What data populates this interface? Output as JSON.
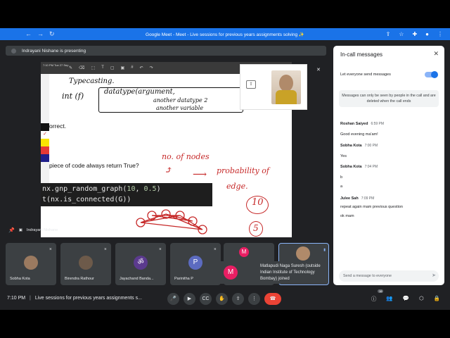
{
  "browser": {
    "tab_title": "Google Meet - Meet - Live sessions for previous years assignments solving ✨",
    "nav_back": "←",
    "nav_forward": "→",
    "reload": "↻"
  },
  "meet": {
    "presenting_text": "Indrayani Nishane is presenting",
    "presenter_label": "Indrayani Nishane",
    "slide": {
      "wb_time": "7:10 PM",
      "wb_date": "Tue 27 Sep",
      "text_correct": "orrect.",
      "text_question": "piece of code always return True?",
      "code_line1_pre": "nx.gnp_random_graph(",
      "code_line1_num1": "10",
      "code_line1_sep": ", ",
      "code_line1_num2": "0.5",
      "code_line1_post": ")",
      "code_line2": "t(nx.is_connected(G))",
      "ink_typecasting": "Typecasting.",
      "ink_int": "int (f)",
      "ink_datatype": "datatype(argument,",
      "ink_another1": "another datatype 2",
      "ink_another2": "another variable",
      "ink_nodes": "no. of nodes",
      "ink_prob": "probability of",
      "ink_edge": "edge.",
      "ink_ten": "10",
      "ink_five": "5"
    },
    "participants": [
      {
        "name": "Sobha Kota",
        "avatar": ""
      },
      {
        "name": "Birendra Rathour",
        "avatar": ""
      },
      {
        "name": "Jayachand Banda...",
        "avatar": "ॐ"
      },
      {
        "name": "Parinitha P",
        "avatar": "P"
      },
      {
        "name": "",
        "avatar": "M"
      }
    ],
    "toast": {
      "avatar": "M",
      "text": "Matlapudi Naga Suresh (outside Indian Institute of Technology Bombay) joined"
    },
    "bottom": {
      "time": "7:10 PM",
      "separator": "|",
      "meeting_title": "Live sessions for previous years assignments s...",
      "people_count": "16"
    }
  },
  "chat": {
    "title": "In-call messages",
    "allow_label": "Let everyone send messages",
    "note": "Messages can only be seen by people in the call and are deleted when the call ends",
    "messages": [
      {
        "sender": "Roshan Saiyed",
        "time": "6:59 PM",
        "lines": [
          "Good evening ma'am!"
        ]
      },
      {
        "sender": "Sobha Kota",
        "time": "7:00 PM",
        "lines": [
          "Yes"
        ]
      },
      {
        "sender": "Sobha Kota",
        "time": "7:04 PM",
        "lines": [
          "b",
          "a"
        ]
      },
      {
        "sender": "Julee Sah",
        "time": "7:09 PM",
        "lines": [
          "repeat again mam previous question",
          "ok mam"
        ]
      }
    ],
    "input_placeholder": "Send a message to everyone"
  },
  "colors": {
    "chrome_blue": "#1a73e8",
    "meet_bg": "#202124",
    "tile_bg": "#3c4043",
    "end_call": "#ea4335"
  }
}
